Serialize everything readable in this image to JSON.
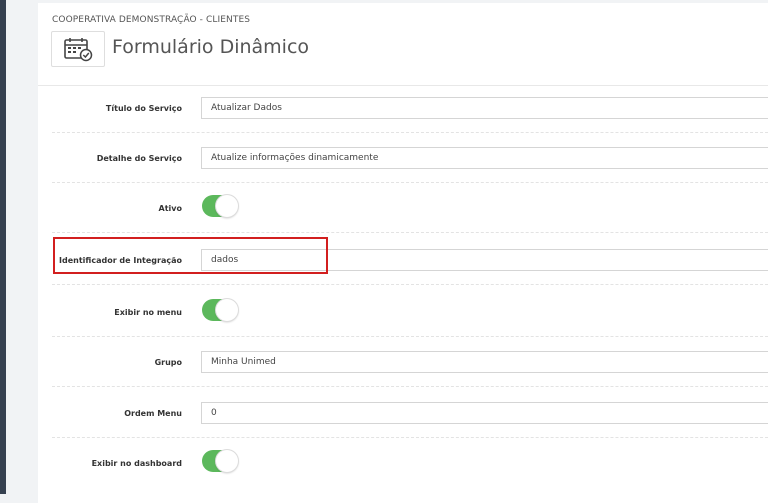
{
  "header": {
    "breadcrumb": "COOPERATIVA DEMONSTRAÇÃO - CLIENTES",
    "title": "Formulário Dinâmico",
    "icon": "calendar-check-icon"
  },
  "form": {
    "titulo": {
      "label": "Título do Serviço",
      "value": "Atualizar Dados"
    },
    "detalhe": {
      "label": "Detalhe do Serviço",
      "value": "Atualize informações dinamicamente"
    },
    "ativo": {
      "label": "Ativo",
      "on": true
    },
    "identificador": {
      "label": "Identificador de Integração",
      "value": "dados"
    },
    "exibir_menu": {
      "label": "Exibir no menu",
      "on": true
    },
    "grupo": {
      "label": "Grupo",
      "value": "Minha Unimed"
    },
    "ordem": {
      "label": "Ordem Menu",
      "value": "0"
    },
    "exibir_dashboard": {
      "label": "Exibir no dashboard",
      "on": true
    }
  },
  "colors": {
    "toggle_on": "#5cb85c",
    "highlight": "#d21f1f",
    "sidebar": "#364150"
  }
}
